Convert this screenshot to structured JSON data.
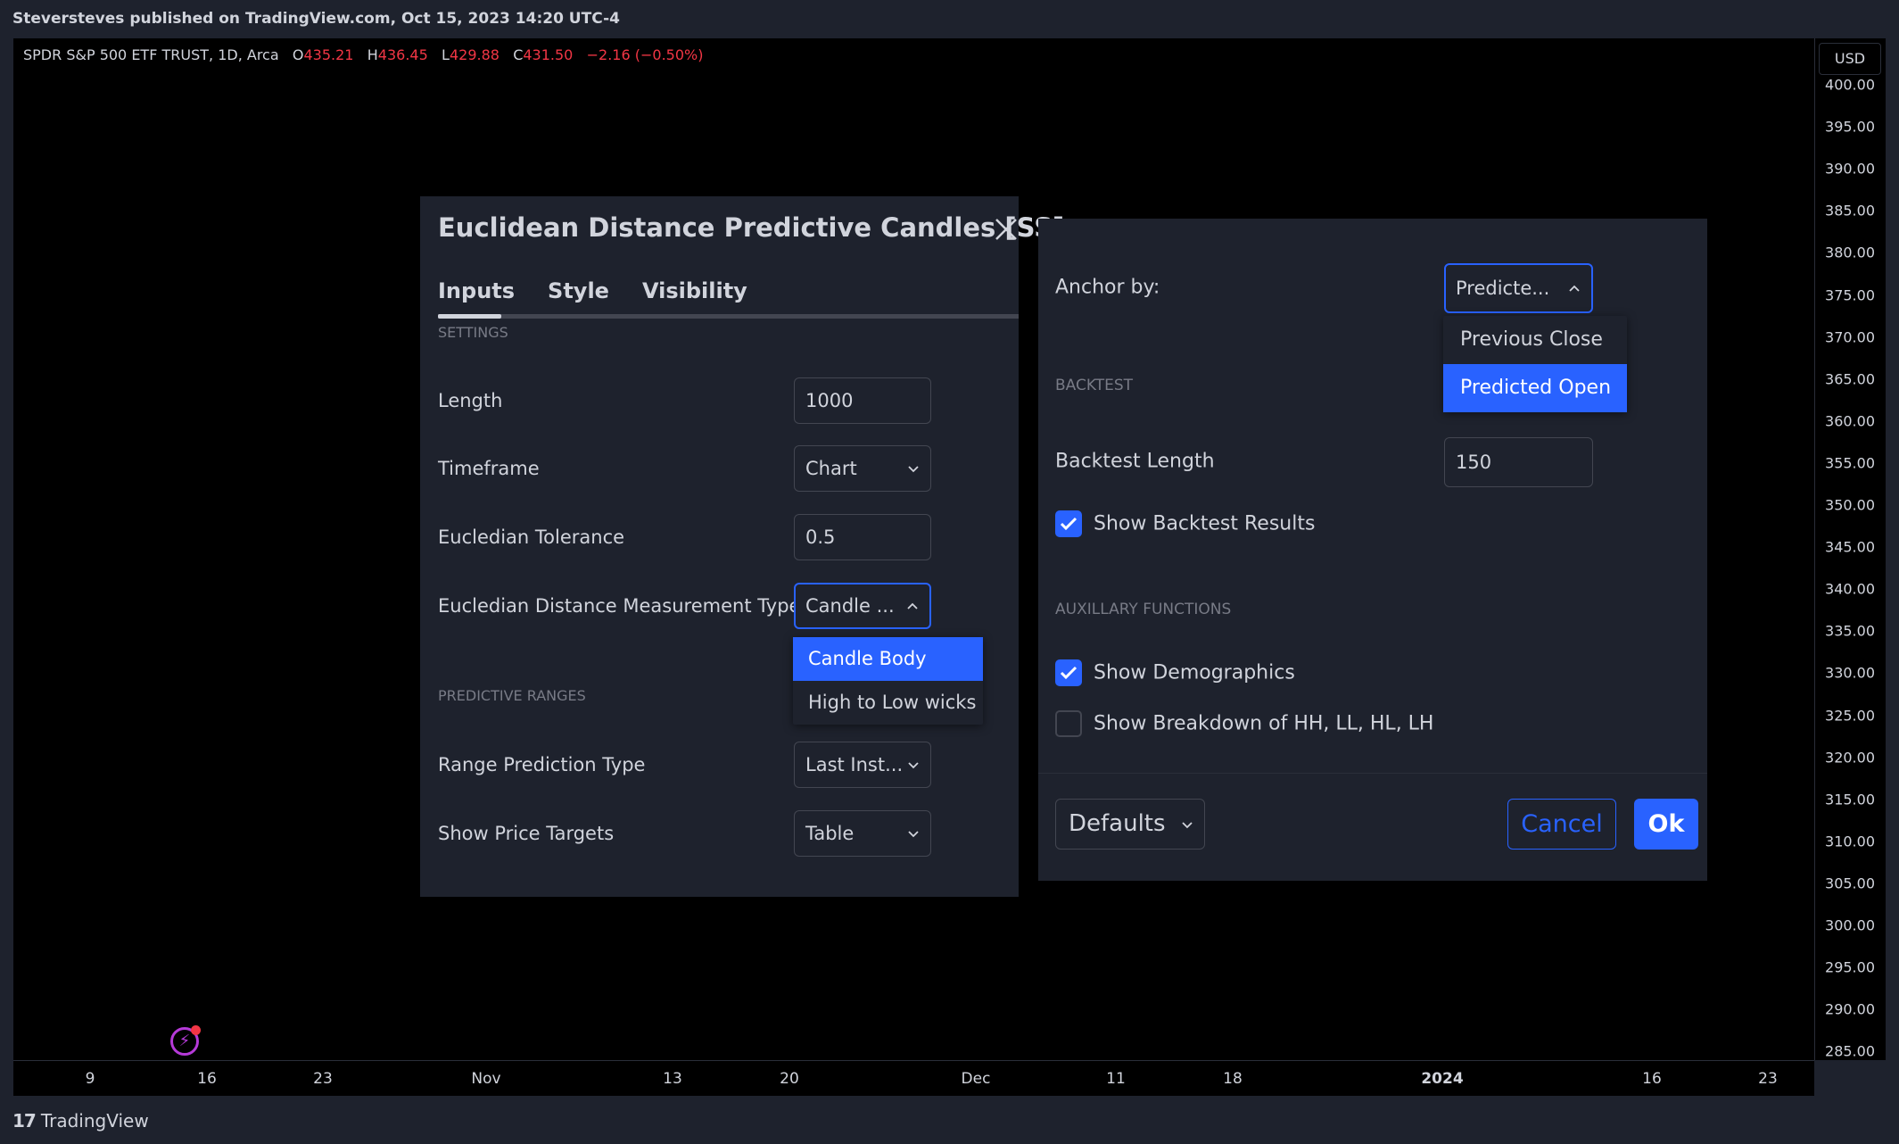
{
  "header": {
    "publisher": "Steversteves published on TradingView.com, Oct 15, 2023 14:20 UTC-4"
  },
  "legend": {
    "symbol": "SPDR S&P 500 ETF TRUST, 1D, Arca",
    "o_label": "O",
    "o_value": "435.21",
    "h_label": "H",
    "h_value": "436.45",
    "l_label": "L",
    "l_value": "429.88",
    "c_label": "C",
    "c_value": "431.50",
    "change": "−2.16 (−0.50%)"
  },
  "currency": "USD",
  "price_axis": [
    "400.00",
    "395.00",
    "390.00",
    "385.00",
    "380.00",
    "375.00",
    "370.00",
    "365.00",
    "360.00",
    "355.00",
    "350.00",
    "345.00",
    "340.00",
    "335.00",
    "330.00",
    "325.00",
    "320.00",
    "315.00",
    "310.00",
    "305.00",
    "300.00",
    "295.00",
    "290.00",
    "285.00"
  ],
  "time_axis": [
    {
      "label": "9"
    },
    {
      "label": "16"
    },
    {
      "label": "23"
    },
    {
      "label": "Nov"
    },
    {
      "label": "13"
    },
    {
      "label": "20"
    },
    {
      "label": "Dec"
    },
    {
      "label": "11"
    },
    {
      "label": "18"
    },
    {
      "label": "2024",
      "bold": true
    },
    {
      "label": "16"
    },
    {
      "label": "23"
    }
  ],
  "footer": {
    "brand": "TradingView",
    "mark": "17"
  },
  "dialog": {
    "title": "Euclidean Distance Predictive Candles [SS]",
    "tabs": [
      "Inputs",
      "Style",
      "Visibility"
    ],
    "settings_header": "SETTINGS",
    "length_label": "Length",
    "length_value": "1000",
    "timeframe_label": "Timeframe",
    "timeframe_value": "Chart",
    "tolerance_label": "Eucledian Tolerance",
    "tolerance_value": "0.5",
    "measure_label": "Eucledian Distance Measurement Type",
    "measure_value": "Candle ...",
    "measure_options": [
      "Candle Body",
      "High to Low wicks"
    ],
    "predictive_header": "PREDICTIVE RANGES",
    "range_label": "Range Prediction Type",
    "range_value": "Last Inst...",
    "targets_label": "Show Price Targets",
    "targets_value": "Table"
  },
  "panel2": {
    "anchor_label": "Anchor by:",
    "anchor_value": "Predicte...",
    "anchor_options": [
      "Previous Close",
      "Predicted Open"
    ],
    "backtest_header": "BACKTEST",
    "backtest_length_label": "Backtest Length",
    "backtest_length_value": "150",
    "show_backtest_label": "Show Backtest Results",
    "aux_header": "AUXILLARY FUNCTIONS",
    "show_demographics_label": "Show Demographics",
    "show_breakdown_label": "Show Breakdown of HH, LL, HL, LH",
    "defaults_label": "Defaults",
    "cancel_label": "Cancel",
    "ok_label": "Ok"
  },
  "colors": {
    "accent": "#2962ff",
    "down": "#f23645",
    "panel": "#1e222d",
    "chart_bg": "#000000"
  }
}
